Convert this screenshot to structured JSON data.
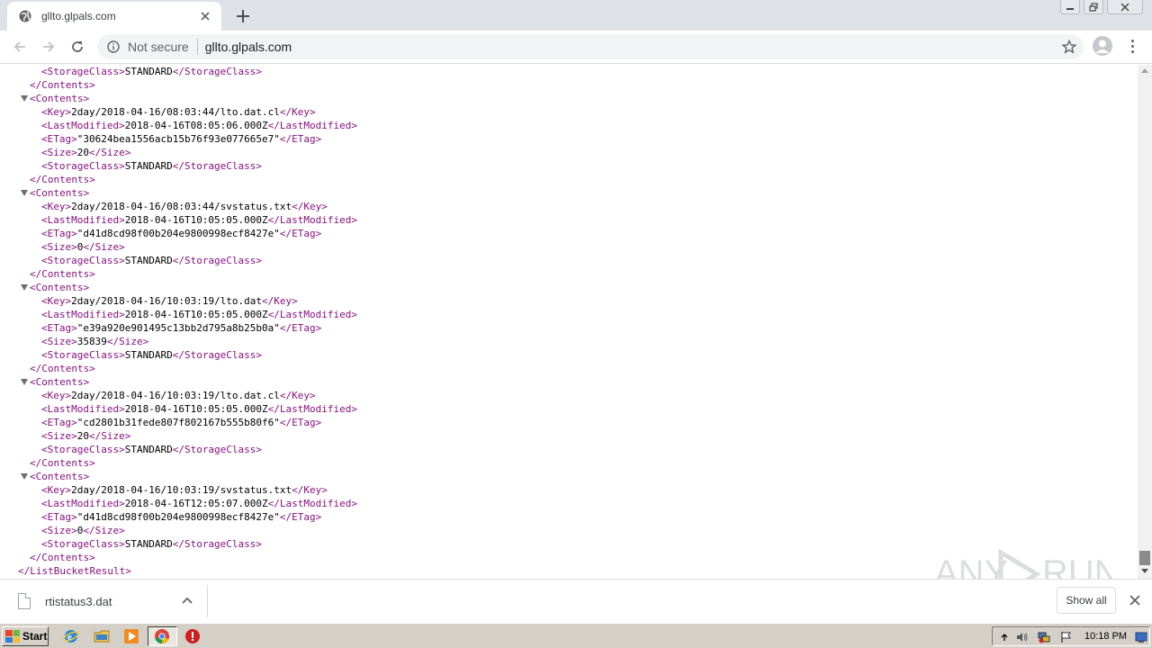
{
  "browser": {
    "tab_title": "gllto.glpals.com",
    "address_security": "Not secure",
    "address_url": "gllto.glpals.com"
  },
  "xml": {
    "lines": [
      {
        "indent": 2,
        "open": "<StorageClass>",
        "text": "STANDARD",
        "close": "</StorageClass>"
      },
      {
        "indent": 1,
        "open": "</Contents>"
      },
      {
        "indent": 1,
        "open": "<Contents>",
        "toggle": true
      },
      {
        "indent": 2,
        "open": "<Key>",
        "text": "2day/2018-04-16/08:03:44/lto.dat.cl",
        "close": "</Key>"
      },
      {
        "indent": 2,
        "open": "<LastModified>",
        "text": "2018-04-16T08:05:06.000Z",
        "close": "</LastModified>"
      },
      {
        "indent": 2,
        "open": "<ETag>",
        "text": "\"30624bea1556acb15b76f93e077665e7\"",
        "close": "</ETag>"
      },
      {
        "indent": 2,
        "open": "<Size>",
        "text": "20",
        "close": "</Size>"
      },
      {
        "indent": 2,
        "open": "<StorageClass>",
        "text": "STANDARD",
        "close": "</StorageClass>"
      },
      {
        "indent": 1,
        "open": "</Contents>"
      },
      {
        "indent": 1,
        "open": "<Contents>",
        "toggle": true
      },
      {
        "indent": 2,
        "open": "<Key>",
        "text": "2day/2018-04-16/08:03:44/svstatus.txt",
        "close": "</Key>"
      },
      {
        "indent": 2,
        "open": "<LastModified>",
        "text": "2018-04-16T10:05:05.000Z",
        "close": "</LastModified>"
      },
      {
        "indent": 2,
        "open": "<ETag>",
        "text": "\"d41d8cd98f00b204e9800998ecf8427e\"",
        "close": "</ETag>"
      },
      {
        "indent": 2,
        "open": "<Size>",
        "text": "0",
        "close": "</Size>"
      },
      {
        "indent": 2,
        "open": "<StorageClass>",
        "text": "STANDARD",
        "close": "</StorageClass>"
      },
      {
        "indent": 1,
        "open": "</Contents>"
      },
      {
        "indent": 1,
        "open": "<Contents>",
        "toggle": true
      },
      {
        "indent": 2,
        "open": "<Key>",
        "text": "2day/2018-04-16/10:03:19/lto.dat",
        "close": "</Key>"
      },
      {
        "indent": 2,
        "open": "<LastModified>",
        "text": "2018-04-16T10:05:05.000Z",
        "close": "</LastModified>"
      },
      {
        "indent": 2,
        "open": "<ETag>",
        "text": "\"e39a920e901495c13bb2d795a8b25b0a\"",
        "close": "</ETag>"
      },
      {
        "indent": 2,
        "open": "<Size>",
        "text": "35839",
        "close": "</Size>"
      },
      {
        "indent": 2,
        "open": "<StorageClass>",
        "text": "STANDARD",
        "close": "</StorageClass>"
      },
      {
        "indent": 1,
        "open": "</Contents>"
      },
      {
        "indent": 1,
        "open": "<Contents>",
        "toggle": true
      },
      {
        "indent": 2,
        "open": "<Key>",
        "text": "2day/2018-04-16/10:03:19/lto.dat.cl",
        "close": "</Key>"
      },
      {
        "indent": 2,
        "open": "<LastModified>",
        "text": "2018-04-16T10:05:05.000Z",
        "close": "</LastModified>"
      },
      {
        "indent": 2,
        "open": "<ETag>",
        "text": "\"cd2801b31fede807f802167b555b80f6\"",
        "close": "</ETag>"
      },
      {
        "indent": 2,
        "open": "<Size>",
        "text": "20",
        "close": "</Size>"
      },
      {
        "indent": 2,
        "open": "<StorageClass>",
        "text": "STANDARD",
        "close": "</StorageClass>"
      },
      {
        "indent": 1,
        "open": "</Contents>"
      },
      {
        "indent": 1,
        "open": "<Contents>",
        "toggle": true
      },
      {
        "indent": 2,
        "open": "<Key>",
        "text": "2day/2018-04-16/10:03:19/svstatus.txt",
        "close": "</Key>"
      },
      {
        "indent": 2,
        "open": "<LastModified>",
        "text": "2018-04-16T12:05:07.000Z",
        "close": "</LastModified>"
      },
      {
        "indent": 2,
        "open": "<ETag>",
        "text": "\"d41d8cd98f00b204e9800998ecf8427e\"",
        "close": "</ETag>"
      },
      {
        "indent": 2,
        "open": "<Size>",
        "text": "0",
        "close": "</Size>"
      },
      {
        "indent": 2,
        "open": "<StorageClass>",
        "text": "STANDARD",
        "close": "</StorageClass>"
      },
      {
        "indent": 1,
        "open": "</Contents>"
      },
      {
        "indent": 0,
        "open": "</ListBucketResult>"
      }
    ]
  },
  "downloads": {
    "file_name": "rtistatus3.dat",
    "show_all_label": "Show all"
  },
  "taskbar": {
    "start_label": "Start",
    "clock": "10:18 PM"
  },
  "watermark": {
    "text_left": "ANY",
    "text_right": "RUN"
  },
  "colors": {
    "xml_tag": "#881280",
    "xml_text": "#000000",
    "tabstrip_bg": "#dee1e6",
    "taskbar_bg": "#d4d0c8"
  },
  "icons": {
    "tab_favicon": "globe-icon",
    "tab_close": "close-icon",
    "new_tab": "plus-icon",
    "back": "arrow-left-icon",
    "forward": "arrow-right-icon",
    "reload": "reload-icon",
    "site_info": "info-icon",
    "bookmark": "star-icon",
    "profile": "user-icon",
    "menu": "more-vertical-icon",
    "download_file": "file-icon",
    "download_menu": "chevron-up-icon",
    "shelf_close": "close-icon"
  }
}
